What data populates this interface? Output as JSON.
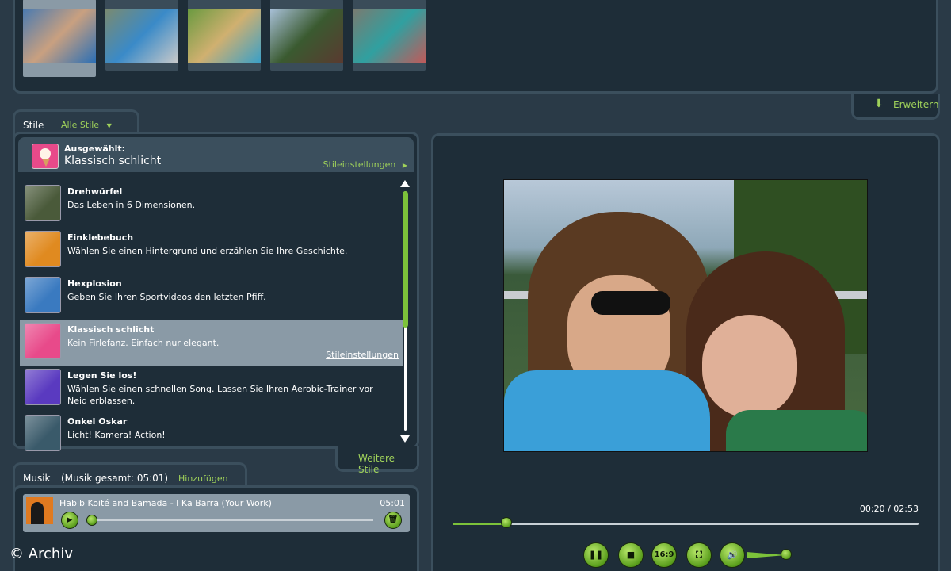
{
  "top": {
    "thumbnails": [
      {
        "colors": [
          "#4a7ab0",
          "#c9a080",
          "#2b6fb5"
        ]
      },
      {
        "colors": [
          "#7a8a70",
          "#3a8ac8",
          "#c9c9c9"
        ]
      },
      {
        "colors": [
          "#6a9a40",
          "#d0b070",
          "#3aa0c8"
        ]
      },
      {
        "colors": [
          "#a8c0d8",
          "#3a5a30",
          "#5a3a30"
        ]
      },
      {
        "colors": [
          "#7a7a70",
          "#30a0a0",
          "#c05a5a"
        ]
      }
    ],
    "expand_label": "Erweitern"
  },
  "styles": {
    "tab_label": "Stile",
    "filter_label": "Alle Stile",
    "selected_caption": "Ausgewählt:",
    "selected_name": "Klassisch schlicht",
    "settings_link": "Stileinstellungen",
    "more_label": "Weitere Stile",
    "items": [
      {
        "name": "Drehwürfel",
        "desc": "Das Leben in 6 Dimensionen.",
        "icon": "cube-icon",
        "color": "#4a5a3a"
      },
      {
        "name": "Einklebebuch",
        "desc": "Wählen Sie einen Hintergrund und erzählen Sie Ihre Geschichte.",
        "icon": "scrapbook-icon",
        "color": "#e08a20"
      },
      {
        "name": "Hexplosion",
        "desc": "Geben Sie Ihren Sportvideos den letzten Pfiff.",
        "icon": "hexplosion-icon",
        "color": "#3a7ac0"
      },
      {
        "name": "Klassisch schlicht",
        "desc": "Kein Firlefanz. Einfach nur elegant.",
        "icon": "ice-cream-icon",
        "color": "#e84a8a",
        "link": "Stileinstellungen"
      },
      {
        "name": "Legen Sie los!",
        "desc": "Wählen Sie einen schnellen Song. Lassen Sie Ihren Aerobic-Trainer vor Neid erblassen.",
        "icon": "disco-icon",
        "color": "#5a3ac0"
      },
      {
        "name": "Onkel Oskar",
        "desc": "Licht! Kamera! Action!",
        "icon": "film-countdown-icon",
        "color": "#3a5a6a"
      }
    ]
  },
  "music": {
    "tab_label": "Musik",
    "total": "(Musik gesamt: 05:01)",
    "add_label": "Hinzufügen",
    "track_title": "Habib Koité and Bamada - I Ka Barra (Your Work)",
    "track_duration": "05:01",
    "track_progress": 0
  },
  "preview": {
    "time": "00:20 / 02:53",
    "progress": 0.115,
    "volume": 0.8,
    "aspect_label": "16:9"
  },
  "watermark": "© Archiv"
}
